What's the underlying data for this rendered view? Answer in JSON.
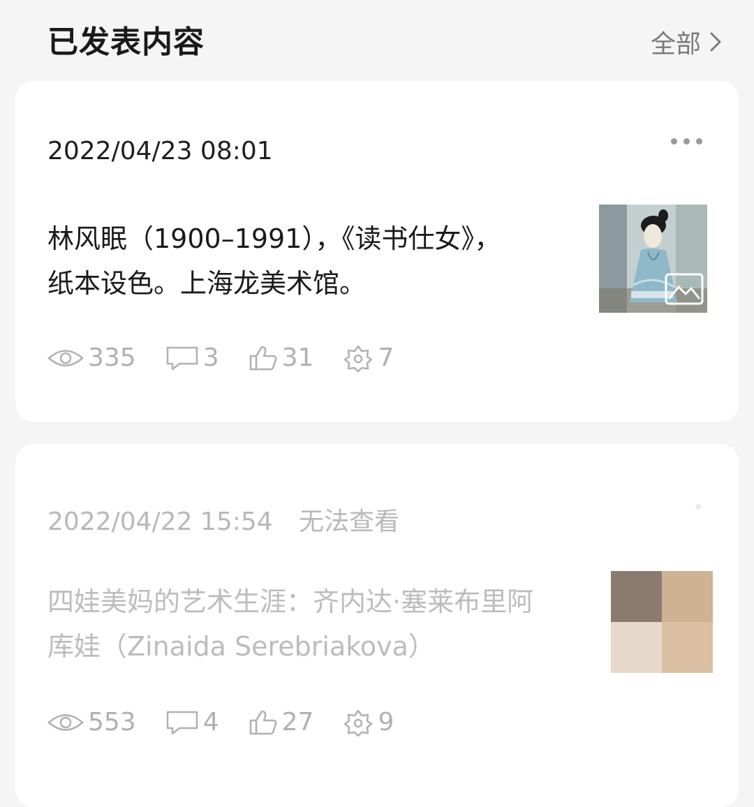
{
  "header": {
    "title": "已发表内容",
    "see_all_label": "全部"
  },
  "posts": [
    {
      "time": "2022/04/23 08:01",
      "status": "",
      "text": "林风眠（1900–1991），《读书仕女》，纸本设色。上海龙美术馆。",
      "stats": {
        "views": "335",
        "comments": "3",
        "likes": "31",
        "shares": "7"
      }
    },
    {
      "time": "2022/04/22 15:54",
      "status": "无法查看",
      "text": "四娃美妈的艺术生涯：齐内达·塞莱布里阿库娃（Zinaida Serebriakova）",
      "stats": {
        "views": "553",
        "comments": "4",
        "likes": "27",
        "shares": "9"
      },
      "thumbnail_colors": [
        "#8b7b6f",
        "#cfb294",
        "#e6d9c9",
        "#dcc0a3"
      ]
    }
  ],
  "colors": {
    "background": "#f5f5f5",
    "card": "#ffffff",
    "muted_text": "#b0b0b0"
  }
}
